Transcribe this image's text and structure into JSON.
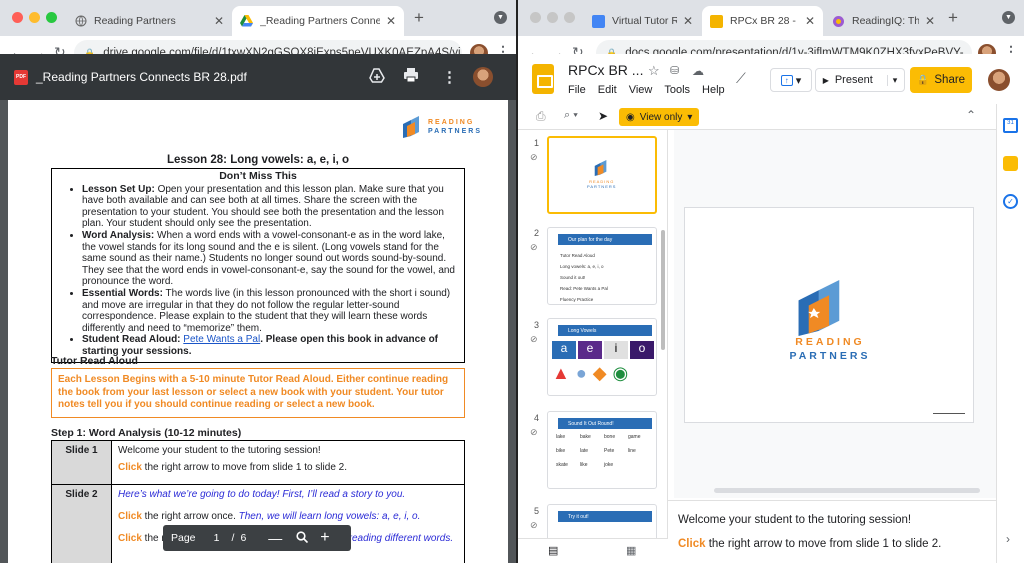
{
  "left": {
    "tabs": [
      {
        "title": "Reading Partners",
        "icon": "globe-icon"
      },
      {
        "title": "_Reading Partners Connects B",
        "icon": "drive-icon"
      }
    ],
    "url": "drive.google.com/file/d/1txwXN2gGSOX8jExps5peVUXK0AEZpA4S/vi...",
    "pdf_badge": "PDF",
    "pdf_title": "_Reading Partners Connects BR 28.pdf",
    "doc": {
      "logo_top": "READING",
      "logo_bottom": "PARTNERS",
      "lesson_title": "Lesson 28: Long vowels: a, e, i, o",
      "dmt_title": "Don’t Miss This",
      "bullets": [
        {
          "label": "Lesson Set Up:",
          "text": " Open your presentation and this lesson plan. Make sure that you have both available and can see both at all times. Share the screen with the presentation to your student.  You should see both the presentation and the lesson plan. Your student should only see the presentation."
        },
        {
          "label": "Word Analysis:",
          "text": " When a word ends with a vowel-consonant-e as in the word lake, the vowel stands for its long sound and the e is silent. (Long vowels stand for the same sound as their name.) Students no longer sound out words sound-by-sound. They see that the word ends in vowel-consonant-e, say the sound for the vowel, and pronounce the word."
        },
        {
          "label": "Essential Words:",
          "text": " The words live (in this lesson pronounced with the short i sound) and move are irregular in that they do not follow the regular letter-sound correspondence. Please explain to the student that they will learn these words differently and need to “memorize” them."
        }
      ],
      "read_aloud_label": "Student Read Aloud:",
      "read_aloud_link": "Pete Wants a Pal",
      "read_aloud_rest": ". Please open this book in advance of starting your sessions.",
      "tutor_heading": "Tutor Read Aloud",
      "tutor_box": "Each Lesson Begins with a 5-10 minute Tutor Read Aloud.  Either continue reading the book from your last lesson or select a new book with your student.  Your tutor notes tell you if you should continue reading or select a new book.",
      "step1_heading": "Step 1: Word Analysis (10-12 minutes)",
      "slide1_label": "Slide 1",
      "slide1_line1": "Welcome your student to the tutoring session!",
      "click_word": "Click",
      "slide1_line2": " the right arrow to move from slide 1 to slide 2.",
      "slide2_label": "Slide 2",
      "slide2_line1": "Here’s what we’re going to do today!  First, I’ll read a story to you.",
      "slide2_line2a": " the right arrow once. ",
      "slide2_line2b": "Then, we will learn long vowels: a, e, i, o.",
      "slide2_line3a": " the rig",
      "slide2_line3b": "out and reading different words."
    },
    "page_ctl": {
      "label": "Page",
      "current": "1",
      "sep": "/",
      "total": "6"
    }
  },
  "right": {
    "tabs": [
      {
        "title": "Virtual Tutor Rea",
        "icon": "docs-icon"
      },
      {
        "title": "RPCx BR 28 - Go",
        "icon": "slides-icon"
      },
      {
        "title": "ReadingIQ: Thous",
        "icon": "readingiq-icon"
      }
    ],
    "url": "docs.google.com/presentation/d/1y-3jflmWTM9K0ZHX3fyxPeBVY-...",
    "doc_title": "RPCx BR ...",
    "menu": [
      "File",
      "Edit",
      "View",
      "Tools",
      "Help"
    ],
    "present_label": "Present",
    "share_label": "Share",
    "view_only": "View only",
    "slides": [
      {
        "num": "1"
      },
      {
        "num": "2",
        "header": "Our plan for the day",
        "items": [
          "Tutor Read Aloud",
          "Long vowels: a, e, i, o",
          "Sound it out!",
          "Read: Pete Wants a Pal",
          "Fluency Practice"
        ]
      },
      {
        "num": "3",
        "header": "Long Vowels",
        "letters": [
          "a",
          "e",
          "i",
          "o"
        ]
      },
      {
        "num": "4",
        "header": "Sound It Out Round!",
        "words": [
          "lake",
          "bake",
          "bone",
          "game",
          "bike",
          "late",
          "Pete",
          "line",
          "skate",
          "like",
          "joke"
        ]
      },
      {
        "num": "5",
        "header": "Try it out!"
      }
    ],
    "main_logo_top": "READING",
    "main_logo_bottom": "PARTNERS",
    "notes_line1": "Welcome your student to the tutoring session!",
    "notes_click": "Click",
    "notes_line2": " the right arrow to move from slide 1 to slide 2."
  }
}
